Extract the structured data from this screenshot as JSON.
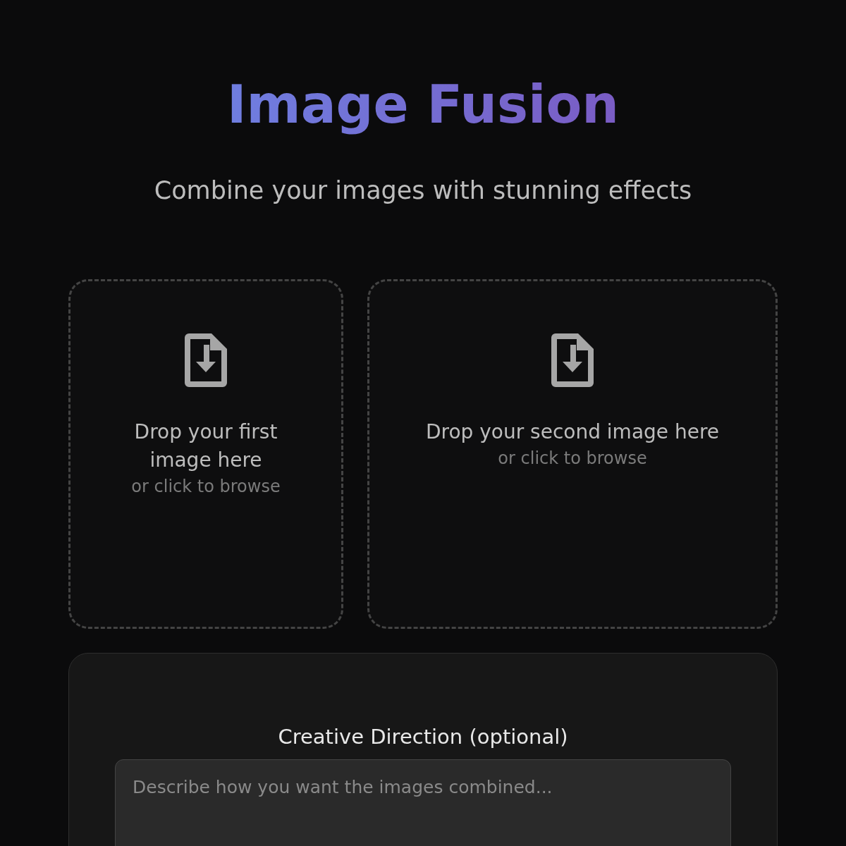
{
  "title": "Image Fusion",
  "subtitle": "Combine your images with stunning effects",
  "dropzones": [
    {
      "title": "Drop your first image here",
      "hint": "or click to browse"
    },
    {
      "title": "Drop your second image here",
      "hint": "or click to browse"
    }
  ],
  "direction": {
    "label": "Creative Direction (optional)",
    "placeholder": "Describe how you want the images combined..."
  }
}
